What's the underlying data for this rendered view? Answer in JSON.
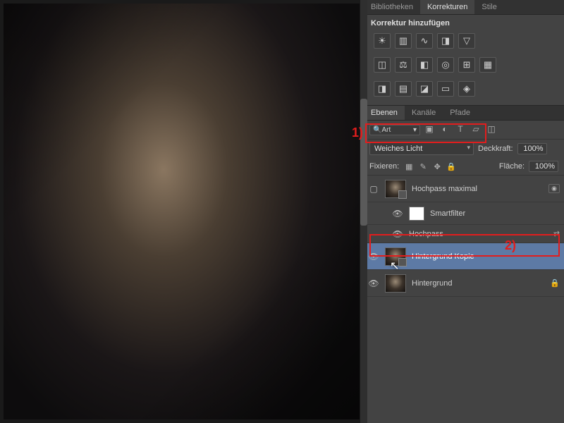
{
  "panel_tabs": {
    "bibliotheken": "Bibliotheken",
    "korrekturen": "Korrekturen",
    "stile": "Stile"
  },
  "adjustments": {
    "title": "Korrektur hinzufügen"
  },
  "panel_tabs2": {
    "ebenen": "Ebenen",
    "kanaele": "Kanäle",
    "pfade": "Pfade"
  },
  "search": {
    "label": "Art"
  },
  "blend": {
    "value": "Weiches Licht",
    "opacity_label": "Deckkraft:",
    "opacity_value": "100%"
  },
  "lock": {
    "label": "Fixieren:",
    "fill_label": "Fläche:",
    "fill_value": "100%"
  },
  "layers": {
    "l1": {
      "name": "Hochpass maximal"
    },
    "l2": {
      "name": "Smartfilter"
    },
    "l3": {
      "name": "Hochpass"
    },
    "l4": {
      "name": "Hintergrund Kopie"
    },
    "l5": {
      "name": "Hintergrund"
    }
  },
  "callouts": {
    "one": "1)",
    "two": "2)"
  }
}
